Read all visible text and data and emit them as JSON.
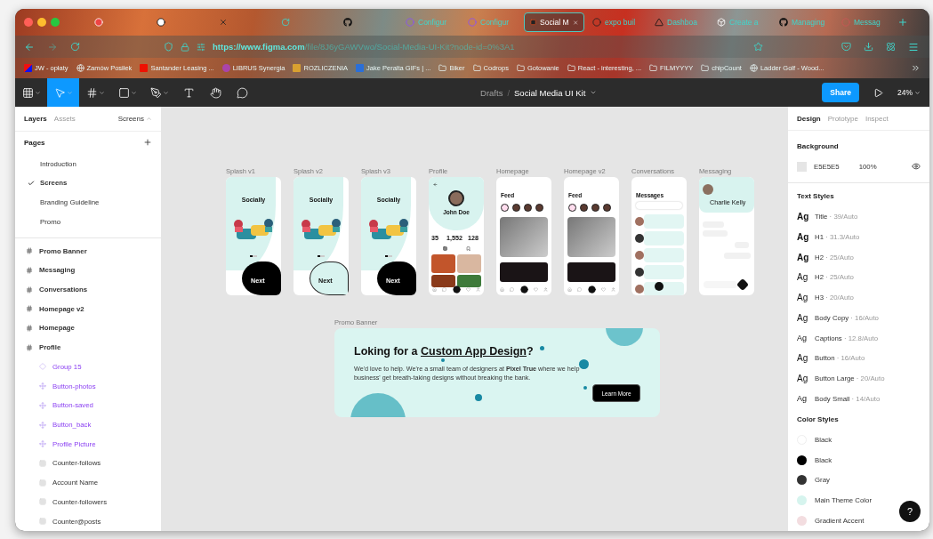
{
  "browser": {
    "tabs": [
      {
        "selected": false
      },
      {
        "selected": false
      },
      {
        "selected": false
      },
      {
        "selected": false
      },
      {
        "selected": false
      },
      {
        "title": "Configur",
        "selected": false
      },
      {
        "title": "Configur",
        "selected": false
      },
      {
        "title": "Social M",
        "selected": true
      },
      {
        "title": "expo buil",
        "selected": false
      },
      {
        "title": "Dashboa",
        "selected": false
      },
      {
        "title": "Create a",
        "selected": false
      },
      {
        "title": "Managing",
        "selected": false
      },
      {
        "title": "Messag",
        "selected": false
      }
    ],
    "url_host": "https://www.figma.com",
    "url_rest": "/file/8J6yGAWVwo/Social-Media-UI-Kit?node-id=0%3A1",
    "bookmarks": [
      {
        "label": "JW - opłaty",
        "kind": "site"
      },
      {
        "label": "Zamów Posiłek",
        "kind": "site"
      },
      {
        "label": "Santander Leasing ...",
        "kind": "site"
      },
      {
        "label": "LIBRUS Synergia",
        "kind": "site"
      },
      {
        "label": "ROZLICZENIA",
        "kind": "site"
      },
      {
        "label": "Jake Peralta GIFs | ...",
        "kind": "site"
      },
      {
        "label": "Biker",
        "kind": "folder"
      },
      {
        "label": "Codrops",
        "kind": "folder"
      },
      {
        "label": "Gotowanie",
        "kind": "folder"
      },
      {
        "label": "React - interesting, ...",
        "kind": "folder"
      },
      {
        "label": "FILMYYYY",
        "kind": "folder"
      },
      {
        "label": "chipCount",
        "kind": "folder"
      },
      {
        "label": "Ladder Golf - Wood...",
        "kind": "site"
      }
    ]
  },
  "toolbar": {
    "tools": [
      {
        "selected": false
      },
      {
        "selected": true
      },
      {
        "selected": false
      },
      {
        "selected": false
      },
      {
        "selected": false
      },
      {
        "selected": false
      },
      {
        "selected": false
      },
      {
        "selected": false
      }
    ],
    "breadcrumb": "Drafts",
    "separator": "/",
    "file_name": "Social Media UI Kit",
    "share": "Share",
    "zoom": "24%"
  },
  "left_panel": {
    "tabs": [
      {
        "label": "Layers",
        "selected": true
      },
      {
        "label": "Assets",
        "selected": false
      }
    ],
    "page_dropdown": "Screens",
    "pages_title": "Pages",
    "pages": [
      {
        "label": "Introduction",
        "selected": false
      },
      {
        "label": "Screens",
        "selected": true
      },
      {
        "label": "Branding Guideline",
        "selected": false
      },
      {
        "label": "Promo",
        "selected": false
      }
    ],
    "layers": [
      {
        "name": "Promo Banner",
        "kind": "frame"
      },
      {
        "name": "Messaging",
        "kind": "frame"
      },
      {
        "name": "Conversations",
        "kind": "frame"
      },
      {
        "name": "Homepage v2",
        "kind": "frame"
      },
      {
        "name": "Homepage",
        "kind": "frame"
      },
      {
        "name": "Profile",
        "kind": "frame",
        "children": [
          {
            "name": "Group 15",
            "kind": "group"
          },
          {
            "name": "Button-photos",
            "kind": "component"
          },
          {
            "name": "Button-saved",
            "kind": "component"
          },
          {
            "name": "Button_back",
            "kind": "component"
          },
          {
            "name": "Profile Picture",
            "kind": "component"
          },
          {
            "name": "Counter-follows",
            "kind": "text"
          },
          {
            "name": "Account Name",
            "kind": "text"
          },
          {
            "name": "Counter-followers",
            "kind": "text"
          },
          {
            "name": "Counter@posts",
            "kind": "text"
          }
        ]
      }
    ]
  },
  "canvas": {
    "frames": [
      {
        "label": "Splash v1",
        "kind": "splash",
        "dark_blob": true,
        "title": "Socially",
        "button": "Next"
      },
      {
        "label": "Splash v2",
        "kind": "splash",
        "dark_blob": false,
        "title": "Socially",
        "button": "Next"
      },
      {
        "label": "Splash v3",
        "kind": "splash",
        "dark_blob": true,
        "title": "Socially",
        "button": "Next"
      },
      {
        "label": "Profile",
        "kind": "profile",
        "title": "John Doe",
        "stats": [
          "35",
          "1,552",
          "128"
        ]
      },
      {
        "label": "Homepage",
        "kind": "feed",
        "title": "Feed"
      },
      {
        "label": "Homepage v2",
        "kind": "feed",
        "title": "Feed"
      },
      {
        "label": "Conversations",
        "kind": "conversations",
        "title": "Messages"
      },
      {
        "label": "Messaging",
        "kind": "messaging",
        "title": "Charlie Kelly"
      }
    ],
    "banner": {
      "label": "Promo Banner",
      "title_start": "Loking for a ",
      "title_link": "Custom App Design",
      "title_end": "?",
      "body": "We'd love to help. We're a small team of designers at **Pixel True** where we help business' get breath-taking designs without breaking the bank.",
      "button": "Learn More"
    }
  },
  "right_panel": {
    "tabs": [
      {
        "label": "Design",
        "selected": true
      },
      {
        "label": "Prototype",
        "selected": false
      },
      {
        "label": "Inspect",
        "selected": false
      }
    ],
    "background_title": "Background",
    "background_hex": "E5E5E5",
    "background_opacity": "100%",
    "text_styles_title": "Text Styles",
    "text_styles": [
      {
        "sample": "Ag",
        "name": "Title",
        "spec": " · 39/Auto",
        "kind": "bold"
      },
      {
        "sample": "Ag",
        "name": "H1",
        "spec": " · 31.3/Auto",
        "kind": "bold"
      },
      {
        "sample": "Ag",
        "name": "H2",
        "spec": " · 25/Auto",
        "kind": "bold"
      },
      {
        "sample": "Ag",
        "name": "H2",
        "spec": " · 25/Auto",
        "kind": "regular"
      },
      {
        "sample": "Ag",
        "name": "H3",
        "spec": " · 20/Auto",
        "kind": "regular"
      },
      {
        "sample": "Ag",
        "name": "Body Copy",
        "spec": " · 16/Auto",
        "kind": "regular"
      },
      {
        "sample": "Ag",
        "name": "Captions",
        "spec": " · 12.8/Auto",
        "kind": "small"
      },
      {
        "sample": "Ag",
        "name": "Button",
        "spec": " · 16/Auto",
        "kind": "regular"
      },
      {
        "sample": "Ag",
        "name": "Button Large",
        "spec": " · 20/Auto",
        "kind": "regular"
      },
      {
        "sample": "Ag",
        "name": "Body Small",
        "spec": " · 14/Auto",
        "kind": "small"
      }
    ],
    "color_styles_title": "Color Styles",
    "color_styles": [
      {
        "name": "Black",
        "color": "#ffffff"
      },
      {
        "name": "Black",
        "color": "#000000"
      },
      {
        "name": "Gray",
        "color": "#333333"
      },
      {
        "name": "Main Theme Color",
        "color": "#d6f4ee"
      },
      {
        "name": "Gradient Accent",
        "color": "#f3dde0"
      }
    ],
    "help": "?"
  }
}
